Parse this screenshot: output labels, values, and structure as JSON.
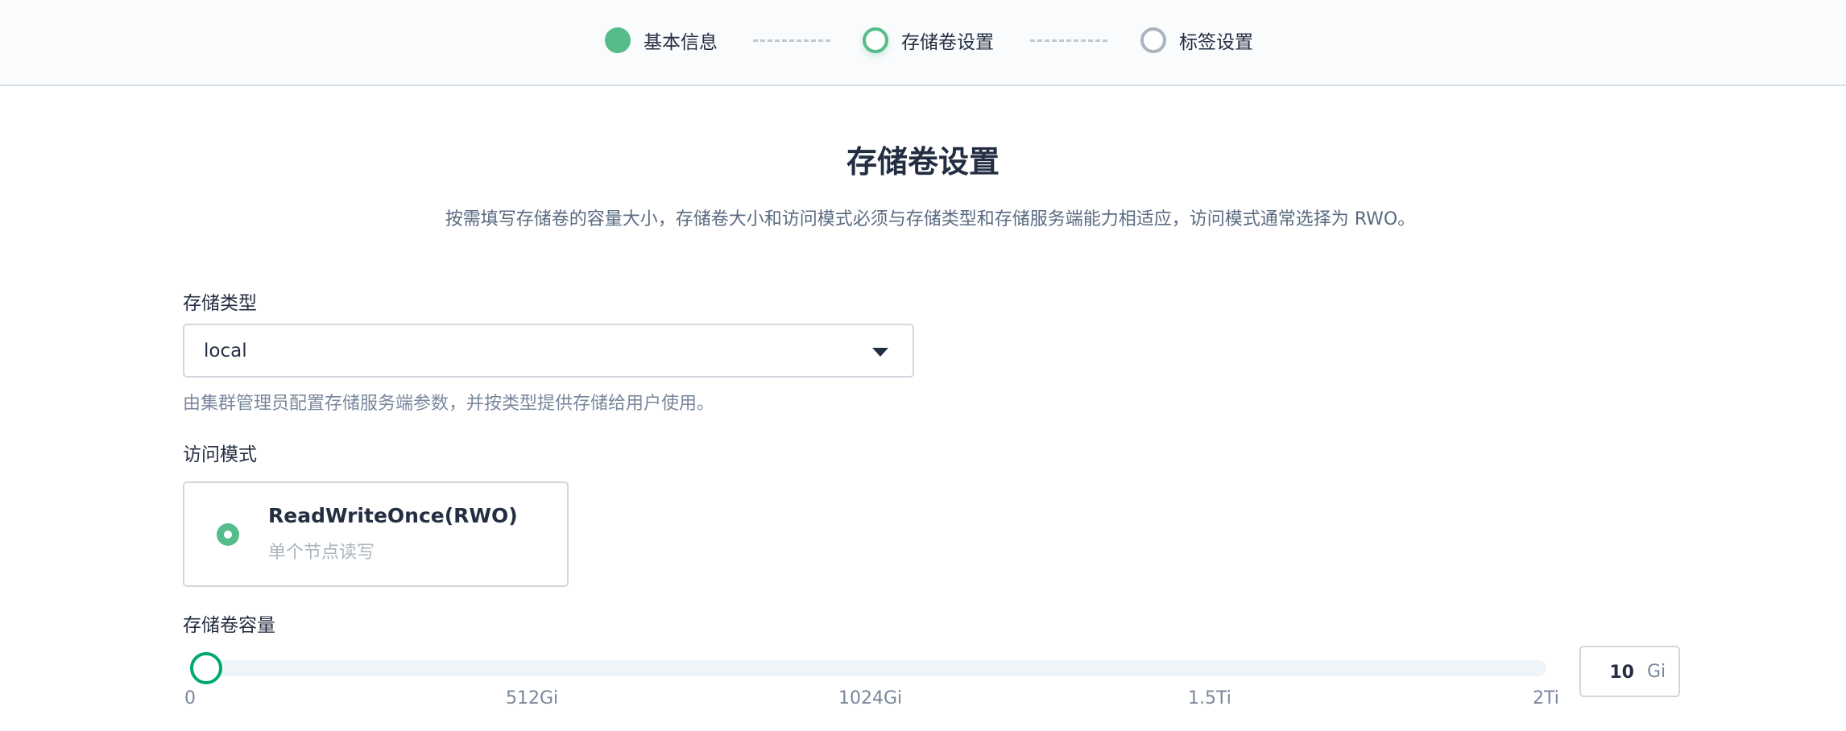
{
  "stepper": {
    "steps": [
      {
        "label": "基本信息",
        "state": "done"
      },
      {
        "label": "存储卷设置",
        "state": "active"
      },
      {
        "label": "标签设置",
        "state": "pending"
      }
    ]
  },
  "page": {
    "title": "存储卷设置",
    "description": "按需填写存储卷的容量大小，存储卷大小和访问模式必须与存储类型和存储服务端能力相适应，访问模式通常选择为 RWO。"
  },
  "storage_class": {
    "label": "存储类型",
    "selected": "local",
    "hint": "由集群管理员配置存储服务端参数，并按类型提供存储给用户使用。"
  },
  "access_mode": {
    "label": "访问模式",
    "option_title": "ReadWriteOnce(RWO)",
    "option_desc": "单个节点读写"
  },
  "capacity": {
    "label": "存储卷容量",
    "ticks": [
      "0",
      "512Gi",
      "1024Gi",
      "1.5Ti",
      "2Ti"
    ],
    "value": "10",
    "value_gi": 10,
    "max_gi": 2048,
    "unit": "Gi"
  },
  "colors": {
    "accent": "#55bc8a",
    "slider_thumb": "#00a971",
    "text": "#242e42",
    "muted": "#79879c"
  }
}
